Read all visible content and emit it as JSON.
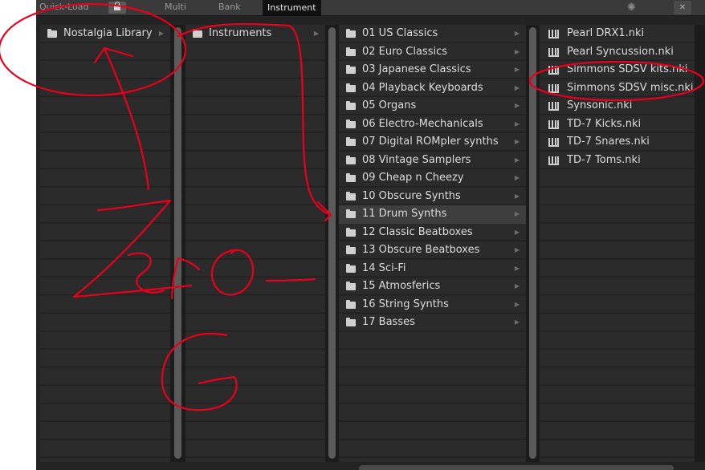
{
  "topbar": {
    "quick_load_label": "Quick-Load",
    "tabs": [
      {
        "label": "Multi"
      },
      {
        "label": "Bank"
      },
      {
        "label": "Instrument",
        "active": true
      }
    ],
    "lock_icon": "lock-icon",
    "spinner_icon": "spinner-icon",
    "close_icon": "close-icon"
  },
  "columns": {
    "libraries": [
      {
        "label": "Nostalgia Library"
      }
    ],
    "library_folders": [
      {
        "label": "Instruments"
      }
    ],
    "categories": [
      {
        "label": "01 US Classics"
      },
      {
        "label": "02 Euro Classics"
      },
      {
        "label": "03 Japanese Classics"
      },
      {
        "label": "04 Playback Keyboards"
      },
      {
        "label": "05 Organs"
      },
      {
        "label": "06 Electro-Mechanicals"
      },
      {
        "label": "07 Digital ROMpler synths"
      },
      {
        "label": "08 Vintage Samplers"
      },
      {
        "label": "09 Cheap n Cheezy"
      },
      {
        "label": "10 Obscure Synths"
      },
      {
        "label": "11 Drum Synths",
        "selected": true
      },
      {
        "label": "12 Classic Beatboxes"
      },
      {
        "label": "13 Obscure Beatboxes"
      },
      {
        "label": "14 Sci-Fi"
      },
      {
        "label": "15 Atmosferics"
      },
      {
        "label": "16 String Synths"
      },
      {
        "label": "17 Basses"
      }
    ],
    "instruments": [
      {
        "label": "Pearl DRX1.nki"
      },
      {
        "label": "Pearl Syncussion.nki"
      },
      {
        "label": "Simmons SDSV kits.nki"
      },
      {
        "label": "Simmons SDSV misc.nki"
      },
      {
        "label": "Synsonic.nki"
      },
      {
        "label": "TD-7 Kicks.nki"
      },
      {
        "label": "TD-7 Snares.nki"
      },
      {
        "label": "TD-7 Toms.nki"
      }
    ]
  },
  "annotation": {
    "color": "#e8001c"
  },
  "colors": {
    "panel_bg": "#232323",
    "row_bg": "#2b2b2b",
    "row_text": "#dcdcdc",
    "selected_row": "#3e3e3e",
    "scrollbar": "#5a5a5a"
  }
}
